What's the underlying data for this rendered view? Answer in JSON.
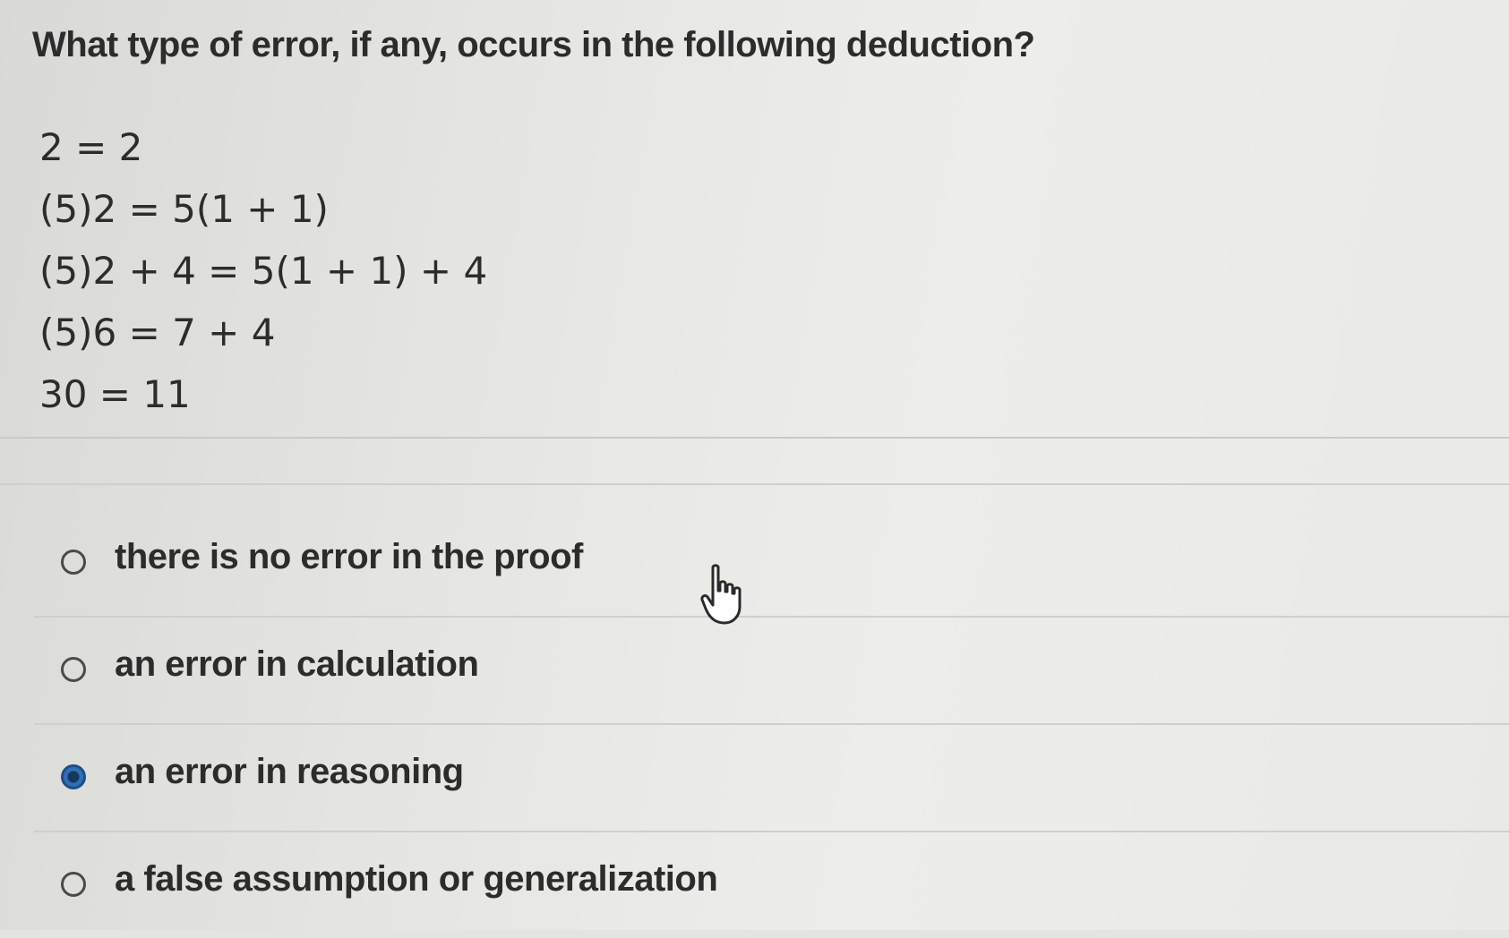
{
  "question": {
    "title": "What type of error, if any, occurs in the following deduction?",
    "deduction_lines": [
      "2 = 2",
      "(5)2 = 5(1 + 1)",
      "(5)2 + 4 = 5(1 + 1) + 4",
      "(5)6 = 7 + 4",
      "30 = 11"
    ]
  },
  "options": [
    {
      "label": "there is no error in the proof",
      "selected": false
    },
    {
      "label": "an error in calculation",
      "selected": false
    },
    {
      "label": "an error in reasoning",
      "selected": true
    },
    {
      "label": "a false assumption or generalization",
      "selected": false
    }
  ],
  "cursor": {
    "icon": "hand-pointer-icon"
  },
  "colors": {
    "selected_radio": "#2f6fb5",
    "text": "#2c2c2c",
    "background": "#e6e6e3"
  }
}
